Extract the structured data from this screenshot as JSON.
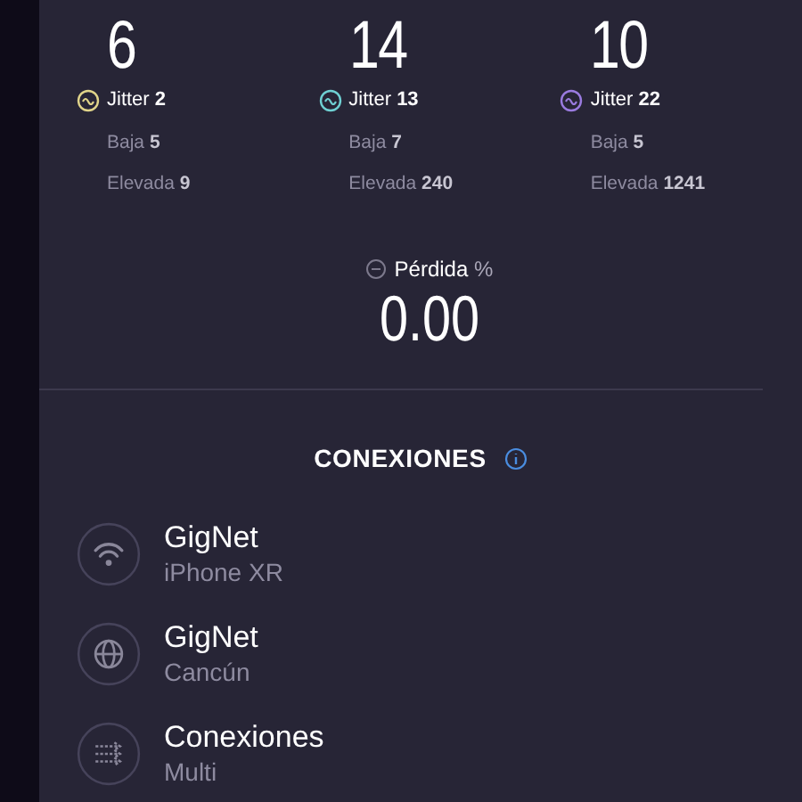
{
  "metrics": [
    {
      "value": "6",
      "jitter_label": "Jitter",
      "jitter": "2",
      "color": "#e0d48a",
      "low_label": "Baja",
      "low": "5",
      "high_label": "Elevada",
      "high": "9"
    },
    {
      "value": "14",
      "jitter_label": "Jitter",
      "jitter": "13",
      "color": "#6fd0d3",
      "low_label": "Baja",
      "low": "7",
      "high_label": "Elevada",
      "high": "240"
    },
    {
      "value": "10",
      "jitter_label": "Jitter",
      "jitter": "22",
      "color": "#9a7be0",
      "low_label": "Baja",
      "low": "5",
      "high_label": "Elevada",
      "high": "1241"
    }
  ],
  "loss": {
    "label": "Pérdida",
    "unit": "%",
    "value": "0.00"
  },
  "connections": {
    "title": "CONEXIONES",
    "items": [
      {
        "kind": "wifi",
        "title": "GigNet",
        "subtitle": "iPhone XR"
      },
      {
        "kind": "globe",
        "title": "GigNet",
        "subtitle": "Cancún"
      },
      {
        "kind": "multi",
        "title": "Conexiones",
        "subtitle": "Multi"
      }
    ]
  }
}
